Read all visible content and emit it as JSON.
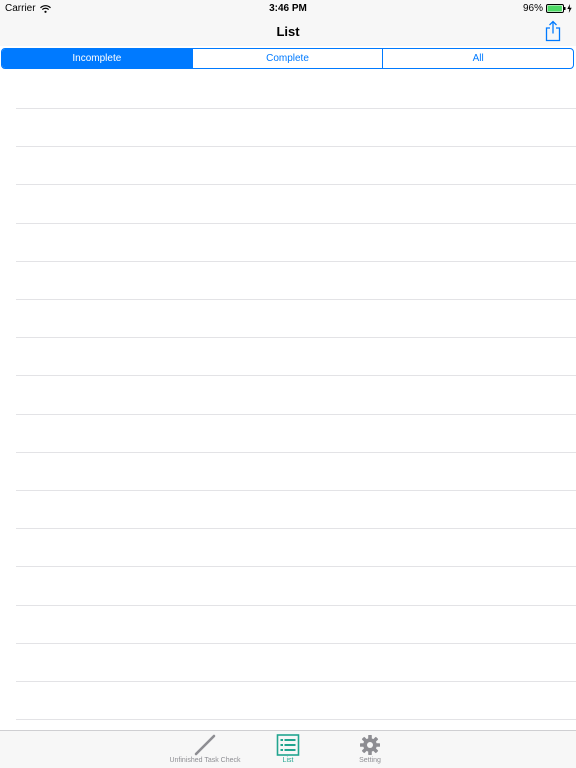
{
  "status_bar": {
    "carrier": "Carrier",
    "time": "3:46 PM",
    "battery": "96%",
    "battery_level": 0.96
  },
  "nav": {
    "title": "List",
    "share_icon": "share-icon"
  },
  "segments": [
    {
      "label": "Incomplete",
      "selected": true
    },
    {
      "label": "Complete",
      "selected": false
    },
    {
      "label": "All",
      "selected": false
    }
  ],
  "tabs": [
    {
      "label": "Unfinished Task Check",
      "icon": "pencil-icon",
      "active": false
    },
    {
      "label": "List",
      "icon": "list-icon",
      "active": true
    },
    {
      "label": "Setting",
      "icon": "gear-icon",
      "active": false
    }
  ],
  "colors": {
    "accent": "#007aff",
    "tab_active": "#22a58f",
    "battery_green": "#4cd964"
  }
}
